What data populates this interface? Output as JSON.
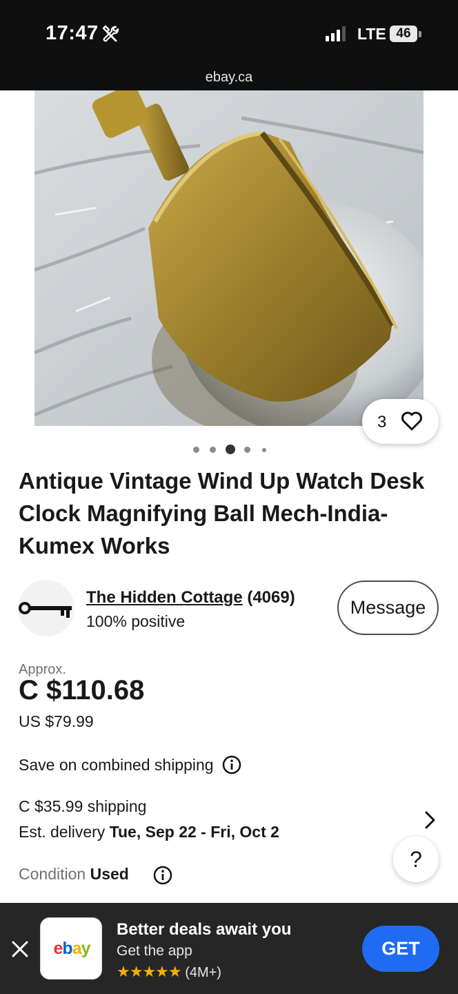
{
  "status_bar": {
    "time": "17:47",
    "network": "LTE",
    "battery": "46",
    "tools_icon": "hammer-wrench-icon",
    "signal_icon": "signal-bars-icon"
  },
  "browser": {
    "url": "ebay.ca"
  },
  "gallery": {
    "favorites_count": "3",
    "heart_icon": "heart-outline-icon",
    "image_count": 5,
    "active_image": 3
  },
  "listing": {
    "title": "Antique Vintage Wind Up Watch Desk Clock Magnifying Ball Mech-India-Kumex Works"
  },
  "seller": {
    "name": "The Hidden Cottage",
    "feedback_count": "(4069)",
    "feedback_percent": "100% positive",
    "avatar_icon": "skeleton-key-icon",
    "message_label": "Message"
  },
  "price": {
    "approx_label": "Approx.",
    "cad": "C $110.68",
    "usd": "US $79.99"
  },
  "shipping": {
    "combined_label": "Save on combined shipping",
    "cost": "C $35.99 shipping",
    "delivery_prefix": "Est. delivery ",
    "delivery_dates": "Tue, Sep 22 - Fri, Oct 2"
  },
  "condition": {
    "label": "Condition",
    "value": "Used"
  },
  "help": {
    "label": "?"
  },
  "app_banner": {
    "title": "Better deals await you",
    "subtitle": "Get the app",
    "stars": "★★★★★",
    "rating_count": "(4M+)",
    "get_label": "GET",
    "logo": {
      "e": "e",
      "b": "b",
      "a": "a",
      "y": "y"
    }
  },
  "colors": {
    "ebay_red": "#e53238",
    "ebay_blue": "#0064d2",
    "ebay_yellow": "#f5af02",
    "ebay_green": "#86b817",
    "get_button": "#1f6bf2"
  }
}
